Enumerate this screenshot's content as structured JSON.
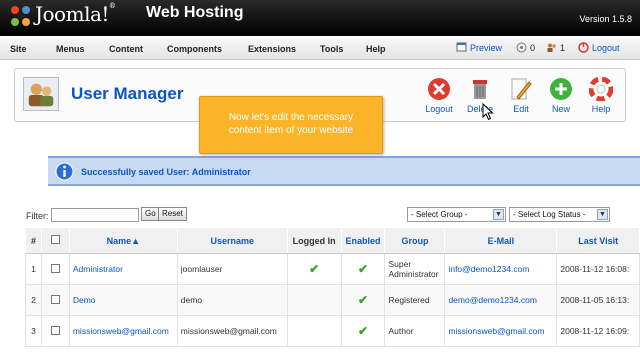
{
  "header": {
    "logo_text": "Joomla!",
    "site_title": "Web Hosting",
    "version": "Version 1.5.8"
  },
  "menu": {
    "items": [
      "Site",
      "Menus",
      "Content",
      "Components",
      "Extensions",
      "Tools",
      "Help"
    ],
    "preview": "Preview",
    "messages_count": "0",
    "users_count": "1",
    "logout": "Logout"
  },
  "toolbar": {
    "title": "User Manager",
    "buttons": [
      "Logout",
      "Delete",
      "Edit",
      "New",
      "Help"
    ]
  },
  "tooltip": {
    "line1": "Now let's edit the necessary",
    "line2": "content item of your website"
  },
  "message": "Successfully saved User: Administrator",
  "filter": {
    "label": "Filter:",
    "go": "Go",
    "reset": "Reset",
    "group_select": "- Select Group -",
    "log_select": "- Select Log Status -"
  },
  "table": {
    "headers": [
      "#",
      "",
      "Name",
      "Username",
      "Logged In",
      "Enabled",
      "Group",
      "E-Mail",
      "Last Visit"
    ],
    "rows": [
      {
        "num": "1",
        "name": "Administrator",
        "username": "joomlauser",
        "logged_in": true,
        "enabled": true,
        "group_line1": "Super",
        "group_line2": "Administrator",
        "email": "info@demo1234.com",
        "last_visit": "2008-11-12 16:08:"
      },
      {
        "num": "2",
        "name": "Demo",
        "username": "demo",
        "logged_in": false,
        "enabled": true,
        "group_line1": "Registered",
        "group_line2": "",
        "email": "demo@demo1234.com",
        "last_visit": "2008-11-05 16:13:"
      },
      {
        "num": "3",
        "name": "missionsweb@gmail.com",
        "username": "missionsweb@gmail.com",
        "logged_in": false,
        "enabled": true,
        "group_line1": "Author",
        "group_line2": "",
        "email": "missionsweb@gmail.com",
        "last_visit": "2008-11-12 16:09:"
      }
    ]
  },
  "colors": {
    "link": "#0b55c4",
    "header_bg": "#000000",
    "tooltip_bg": "#fbb428",
    "message_bg": "#c7daf1",
    "check": "#3aa51f"
  }
}
